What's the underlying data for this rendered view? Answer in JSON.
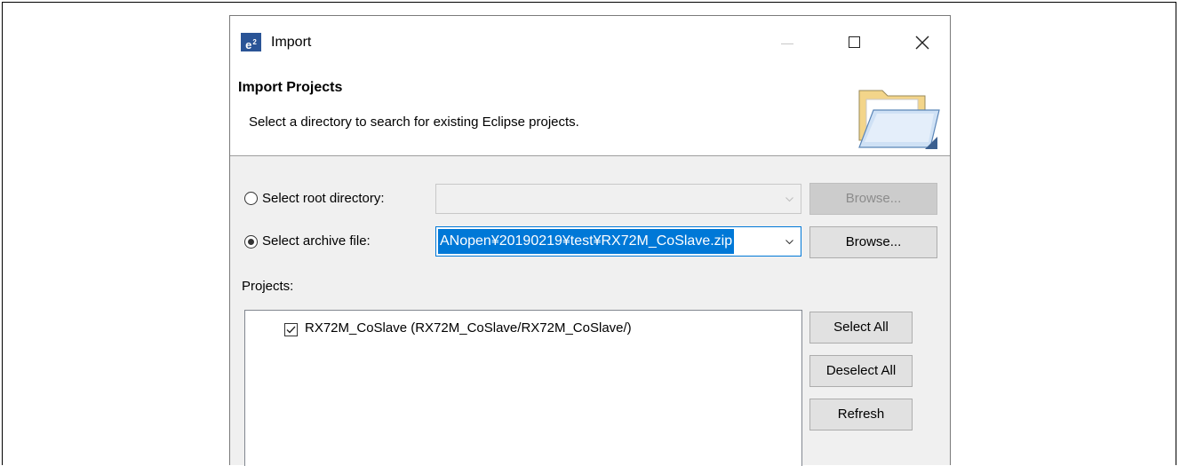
{
  "window": {
    "title": "Import",
    "app_icon": "e2"
  },
  "header": {
    "title": "Import Projects",
    "description": "Select a directory to search for existing Eclipse projects.",
    "icon": "open-folder-wizard-icon"
  },
  "root_directory": {
    "label": "Select root directory:",
    "selected": false,
    "value": "",
    "enabled": false,
    "browse_label": "Browse..."
  },
  "archive_file": {
    "label": "Select archive file:",
    "selected": true,
    "value": "ANopen¥20190219¥test¥RX72M_CoSlave.zip",
    "browse_label": "Browse..."
  },
  "projects": {
    "label": "Projects:",
    "items": [
      {
        "label": "RX72M_CoSlave (RX72M_CoSlave/RX72M_CoSlave/)",
        "checked": true
      }
    ]
  },
  "buttons": {
    "select_all": "Select All",
    "deselect_all": "Deselect All",
    "refresh": "Refresh"
  },
  "colors": {
    "selection": "#0078d7",
    "dialog_bg": "#f0f0f0",
    "button_bg": "#e1e1e1"
  }
}
